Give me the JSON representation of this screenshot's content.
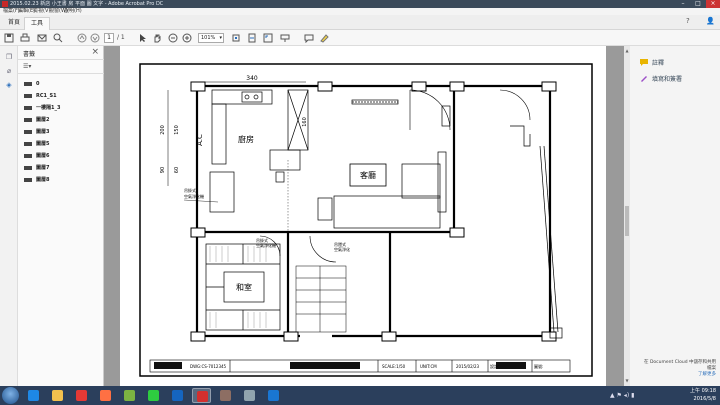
{
  "window": {
    "title": "2015.02.23 新店 小王書 房 平面 圖 文字 - Adobe Acrobat Pro DC"
  },
  "menus": [
    "檔案(F)",
    "編輯(E)",
    "檢視(V)",
    "視窗(W)",
    "說明(H)"
  ],
  "tabs": [
    {
      "label": "首頁"
    },
    {
      "label": "工具"
    }
  ],
  "tab_right": {
    "help": "?",
    "user": "👤"
  },
  "toolbar": {
    "page_current": "1",
    "page_total": "/ 1",
    "zoom": "101%"
  },
  "bookmarks_panel": {
    "title": "書籤",
    "items": [
      "0",
      "RC1_S1",
      "一樓隔1_3",
      "圖層2",
      "圖層3",
      "圖層5",
      "圖層6",
      "圖層7",
      "圖層8"
    ]
  },
  "right_panel": {
    "items": [
      {
        "label": "註釋",
        "color": "#e8b400"
      },
      {
        "label": "填寫和簽署",
        "color": "#9c4fc8"
      }
    ],
    "footer_line1": "在 Document Cloud 中儲存和共用",
    "footer_line2": "檔案",
    "footer_link": "了解更多"
  },
  "floorplan": {
    "dim_top": "340",
    "dim_left_1": "200",
    "dim_left_2": "150",
    "dim_left_3": "90",
    "dim_left_4": "60",
    "dim_inner": "160",
    "ac_label": "A.C",
    "kitchen": "廚房",
    "living": "客廳",
    "japanese_room": "和室",
    "fixture_note_1": "吊掛式",
    "fixture_note_2": "空氣淨化機",
    "fixture_note_3": "吊掛式",
    "fixture_note_4": "空氣淨化機",
    "fixture_note_5": "吊隱式",
    "fixture_note_6": "空氣淨化",
    "title_block": {
      "dwg_no": "DWG:CS-7012345",
      "scale": "SCALE:1/50",
      "unit": "UNIT:CM",
      "date": "2015/02/23",
      "designer_label": "設計:",
      "drawing_label": "圖號:"
    }
  },
  "taskbar": {
    "apps": [
      {
        "name": "ie",
        "color": "#1e88e5"
      },
      {
        "name": "folder",
        "color": "#f2c14e"
      },
      {
        "name": "chrome",
        "color": "#e53935"
      },
      {
        "name": "firefox",
        "color": "#ff7043"
      },
      {
        "name": "media",
        "color": "#7cb342"
      },
      {
        "name": "line",
        "color": "#2ecc40"
      },
      {
        "name": "outlook",
        "color": "#1565c0"
      },
      {
        "name": "acrobat",
        "color": "#d32f2f"
      },
      {
        "name": "tool",
        "color": "#8d6e63"
      },
      {
        "name": "paint",
        "color": "#90a4ae"
      },
      {
        "name": "word",
        "color": "#1976d2"
      }
    ],
    "time": "上午 09:18",
    "date": "2016/5/8"
  }
}
